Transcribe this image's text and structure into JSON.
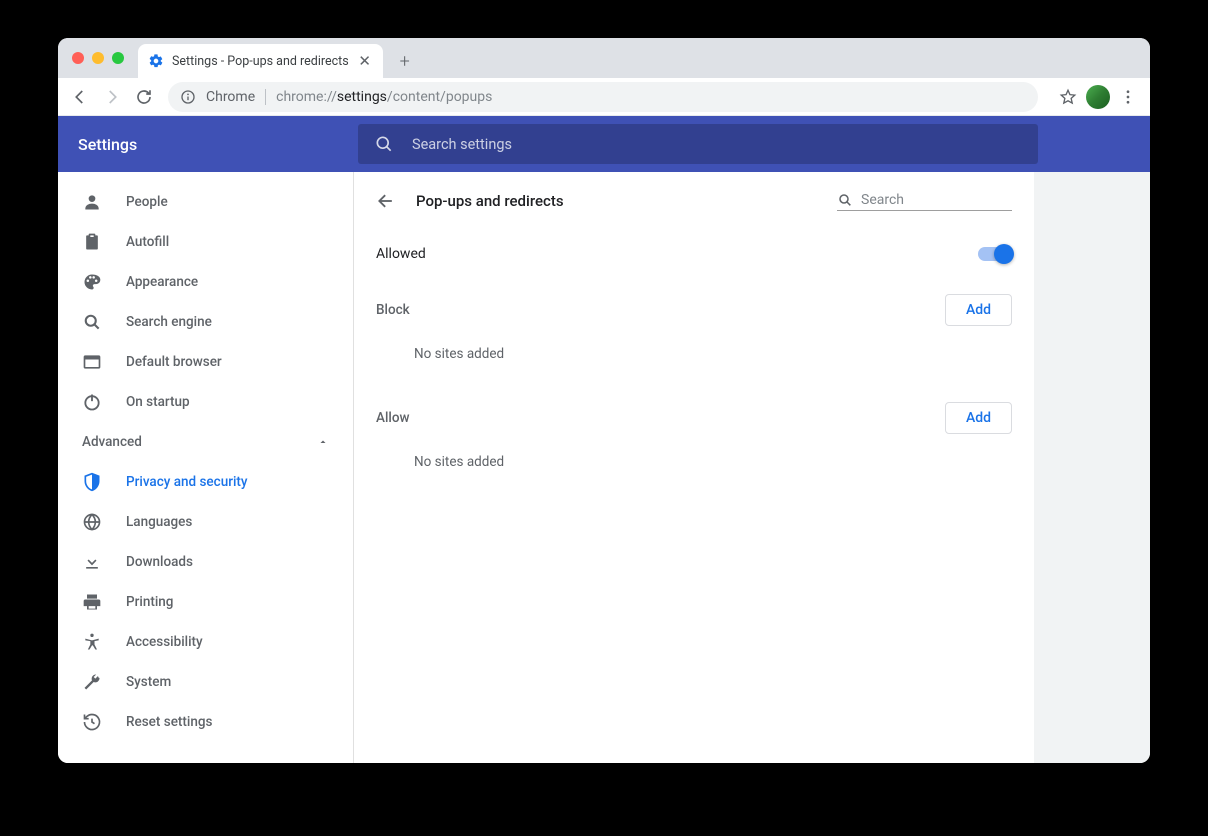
{
  "browser": {
    "tab_title": "Settings - Pop-ups and redirects",
    "origin_label": "Chrome",
    "url_prefix": "chrome://",
    "url_strong": "settings",
    "url_suffix": "/content/popups"
  },
  "header": {
    "app_title": "Settings",
    "search_placeholder": "Search settings"
  },
  "sidebar": {
    "items": [
      {
        "label": "People",
        "icon": "person"
      },
      {
        "label": "Autofill",
        "icon": "clipboard"
      },
      {
        "label": "Appearance",
        "icon": "palette"
      },
      {
        "label": "Search engine",
        "icon": "search"
      },
      {
        "label": "Default browser",
        "icon": "browser"
      },
      {
        "label": "On startup",
        "icon": "power"
      }
    ],
    "advanced_label": "Advanced",
    "advanced_items": [
      {
        "label": "Privacy and security",
        "icon": "shield",
        "active": true
      },
      {
        "label": "Languages",
        "icon": "globe"
      },
      {
        "label": "Downloads",
        "icon": "download"
      },
      {
        "label": "Printing",
        "icon": "printer"
      },
      {
        "label": "Accessibility",
        "icon": "accessibility"
      },
      {
        "label": "System",
        "icon": "wrench"
      },
      {
        "label": "Reset settings",
        "icon": "restore"
      }
    ]
  },
  "page": {
    "title": "Pop-ups and redirects",
    "search_placeholder": "Search",
    "allowed_label": "Allowed",
    "block_label": "Block",
    "allow_label": "Allow",
    "add_label": "Add",
    "empty_label": "No sites added"
  }
}
